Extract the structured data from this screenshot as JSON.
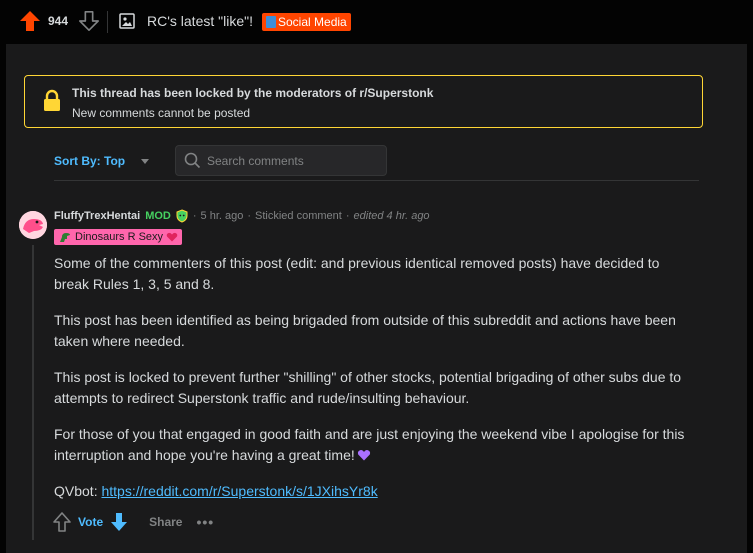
{
  "post": {
    "score": "944",
    "title": "RC's latest \"like\"!",
    "flair": "Social Media"
  },
  "locked_notice": {
    "title": "This thread has been locked by the moderators of r/Superstonk",
    "subtitle": "New comments cannot be posted"
  },
  "sort": {
    "label": "Sort By: Top"
  },
  "search": {
    "placeholder": "Search comments"
  },
  "comment": {
    "author": "FluffyTrexHentai",
    "role": "MOD",
    "dot": "·",
    "time": "5 hr. ago",
    "stickied": "Stickied comment",
    "edited": "edited 4 hr. ago",
    "user_flair": "Dinosaurs R Sexy",
    "paragraphs": [
      "Some of the commenters of this post (edit: and previous identical removed posts) have decided to break Rules 1, 3, 5 and 8.",
      "This post has been identified as being brigaded from outside of this subreddit and actions have been taken where needed.",
      "This post is locked to prevent further \"shilling\" of other stocks, potential brigading of other subs due to attempts to redirect Superstonk traffic and rude/insulting behaviour.",
      "For those of you that engaged in good faith and are just enjoying the weekend vibe I apologise for this interruption and hope you're having a great time!"
    ],
    "qvbot_label": "QVbot: ",
    "qvbot_link": "https://reddit.com/r/Superstonk/s/1JXihsYr8k",
    "actions": {
      "vote": "Vote",
      "share": "Share",
      "more": "•••"
    }
  },
  "colors": {
    "background": "#1a1a1b",
    "accent": "#4fbcff",
    "upvote": "#ff4500",
    "locked_border": "#ffd635",
    "mod_green": "#46d160",
    "flair_pink": "#ff66ac"
  },
  "icons": [
    "upvote-icon",
    "downvote-icon",
    "post-image-icon",
    "lock-icon",
    "search-icon",
    "mod-shield-icon",
    "dino-icon",
    "heart-icon",
    "purple-heart-icon"
  ]
}
